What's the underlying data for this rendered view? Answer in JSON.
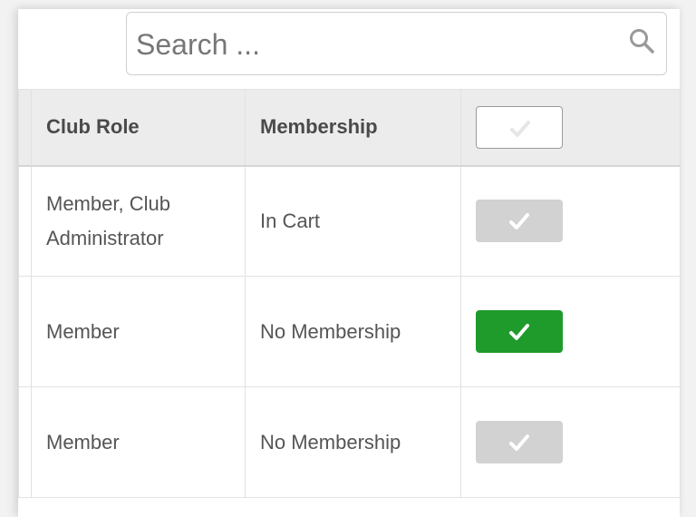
{
  "search": {
    "placeholder": "Search ..."
  },
  "table": {
    "columns": [
      "Club Role",
      "Membership",
      ""
    ],
    "rows": [
      {
        "club_role": "Member, Club Administrator",
        "membership": "In Cart",
        "selected": false
      },
      {
        "club_role": "Member",
        "membership": "No Membership",
        "selected": true
      },
      {
        "club_role": "Member",
        "membership": "No Membership",
        "selected": false
      }
    ]
  },
  "colors": {
    "selected": "#1e9b2b",
    "unselected": "#d2d2d2",
    "header_bg": "#ececec"
  },
  "icons": {
    "search": "search-icon",
    "check": "check-icon"
  }
}
